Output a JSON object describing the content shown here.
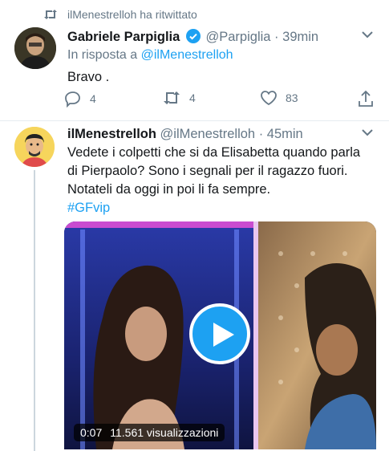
{
  "retweet_context": {
    "text": "ilMenestrelloh ha ritwittato",
    "icon": "retweet-icon"
  },
  "tweet1": {
    "display_name": "Gabriele Parpiglia",
    "verified": true,
    "handle": "@Parpiglia",
    "separator": "·",
    "time": "39min",
    "reply_prefix": "In risposta a ",
    "reply_handle": "@ilMenestrelloh",
    "text": "Bravo .",
    "replies": "4",
    "retweets": "4",
    "likes": "83"
  },
  "tweet2": {
    "display_name": "ilMenestrelloh",
    "handle": "@ilMenestrelloh",
    "separator": "·",
    "time": "45min",
    "text_line1": "Vedete i colpetti che si da Elisabetta quando parla",
    "text_line2": "di Pierpaolo? Sono i segnali per il ragazzo fuori.",
    "text_line3": "Notateli da oggi in poi li fa sempre.",
    "hashtag": "#GFvip",
    "video": {
      "elapsed": "0:07",
      "views": "11.561 visualizzazioni"
    }
  },
  "colors": {
    "accent": "#1da1f2",
    "muted": "#657786",
    "text": "#14171a",
    "divider": "#e6ecf0"
  }
}
